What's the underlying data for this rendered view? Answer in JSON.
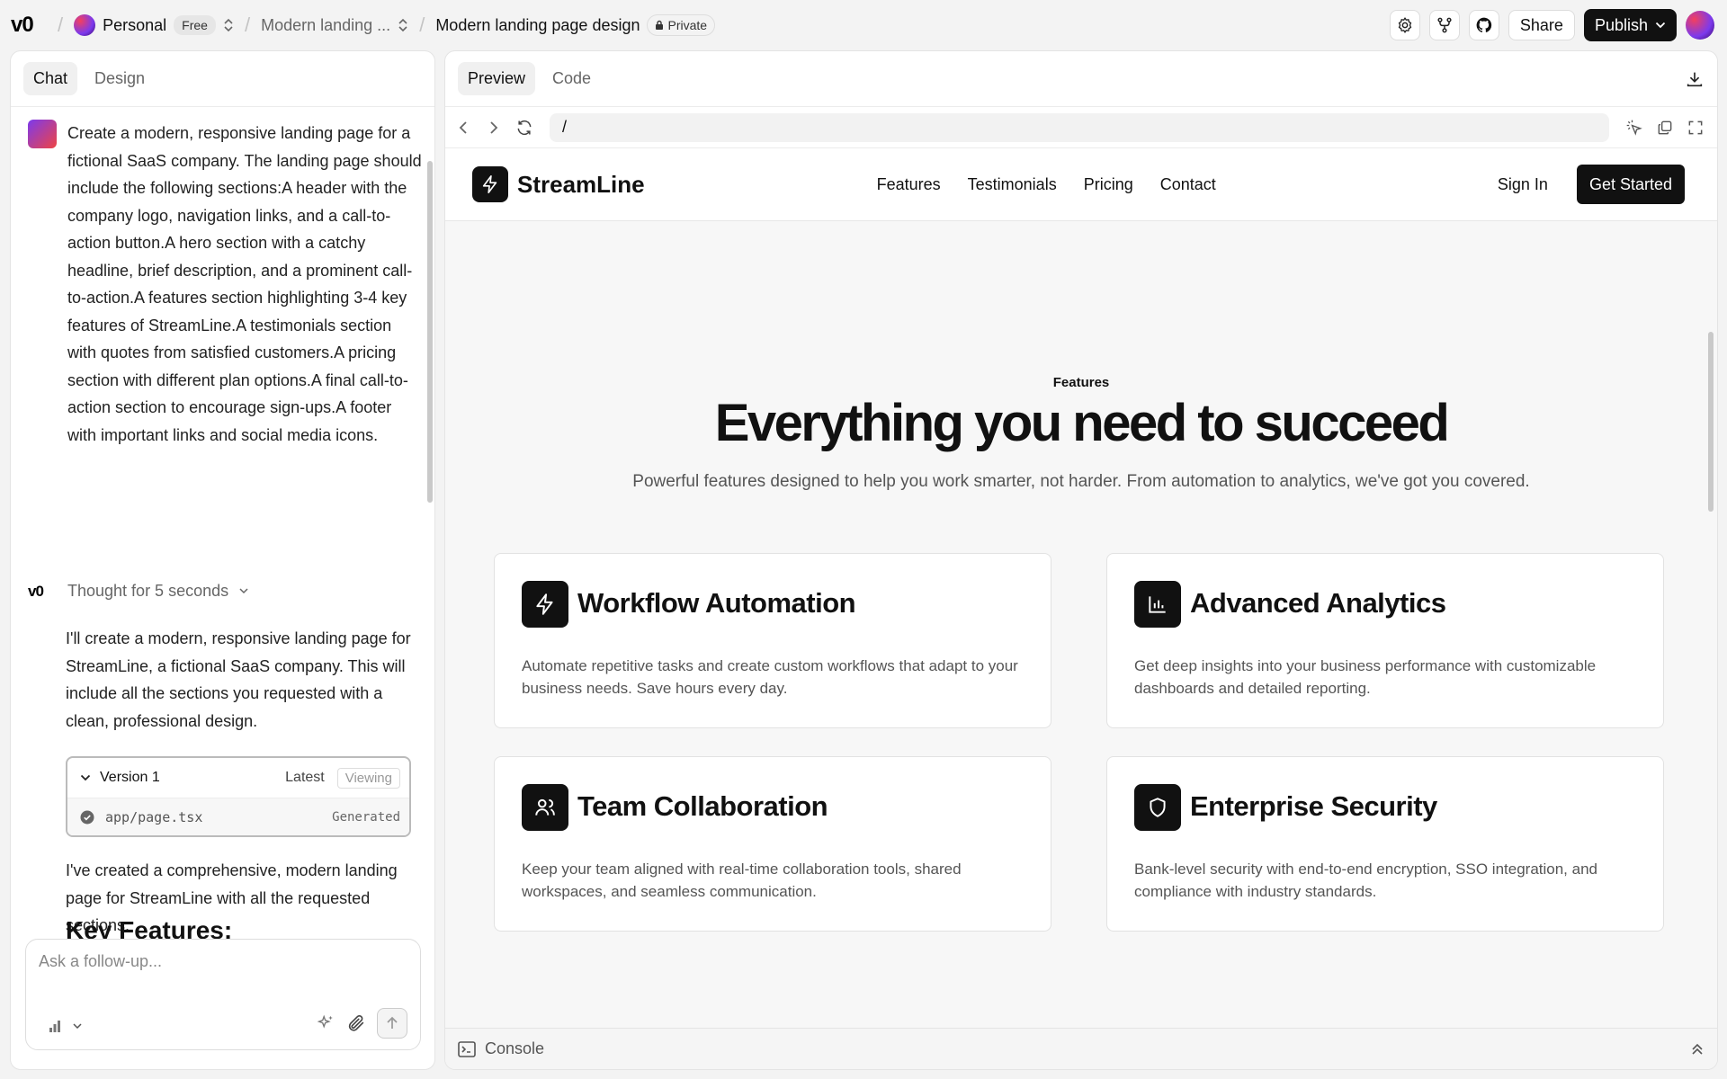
{
  "topbar": {
    "logo": "v0",
    "workspace": "Personal",
    "plan_badge": "Free",
    "project": "Modern landing ...",
    "page_title": "Modern landing page design",
    "privacy": "Private",
    "share_label": "Share",
    "publish_label": "Publish"
  },
  "left": {
    "tabs": [
      "Chat",
      "Design"
    ],
    "user_message": "Create a modern, responsive landing page for a fictional SaaS company. The landing page should include the following sections:A header with the company logo, navigation links, and a call-to-action button.A hero section with a catchy headline, brief description, and a prominent call-to-action.A features section highlighting 3-4 key features of StreamLine.A testimonials section with quotes from satisfied customers.A pricing section with different plan options.A final call-to-action section to encourage sign-ups.A footer with important links and social media icons.",
    "thought": "Thought for 5 seconds",
    "reply1": "I'll create a modern, responsive landing page for StreamLine, a fictional SaaS company. This will include all the sections you requested with a clean, professional design.",
    "version": {
      "title": "Version 1",
      "latest": "Latest",
      "viewing": "Viewing",
      "file": "app/page.tsx",
      "status": "Generated"
    },
    "reply2": "I've created a comprehensive, modern landing page for StreamLine with all the requested sections:",
    "key_features": "Key Features:",
    "input_placeholder": "Ask a follow-up..."
  },
  "right": {
    "tabs": [
      "Preview",
      "Code"
    ],
    "url": "/",
    "console": "Console"
  },
  "site": {
    "brand": "StreamLine",
    "nav": [
      "Features",
      "Testimonials",
      "Pricing",
      "Contact"
    ],
    "sign_in": "Sign In",
    "cta": "Get Started",
    "section_label": "Features",
    "headline": "Everything you need to succeed",
    "subheadline": "Powerful features designed to help you work smarter, not harder. From automation to analytics, we've got you covered.",
    "features": [
      {
        "icon": "lightning-icon",
        "title": "Workflow Automation",
        "desc": "Automate repetitive tasks and create custom workflows that adapt to your business needs. Save hours every day."
      },
      {
        "icon": "bar-chart-icon",
        "title": "Advanced Analytics",
        "desc": "Get deep insights into your business performance with customizable dashboards and detailed reporting."
      },
      {
        "icon": "users-icon",
        "title": "Team Collaboration",
        "desc": "Keep your team aligned with real-time collaboration tools, shared workspaces, and seamless communication."
      },
      {
        "icon": "shield-icon",
        "title": "Enterprise Security",
        "desc": "Bank-level security with end-to-end encryption, SSO integration, and compliance with industry standards."
      }
    ]
  }
}
